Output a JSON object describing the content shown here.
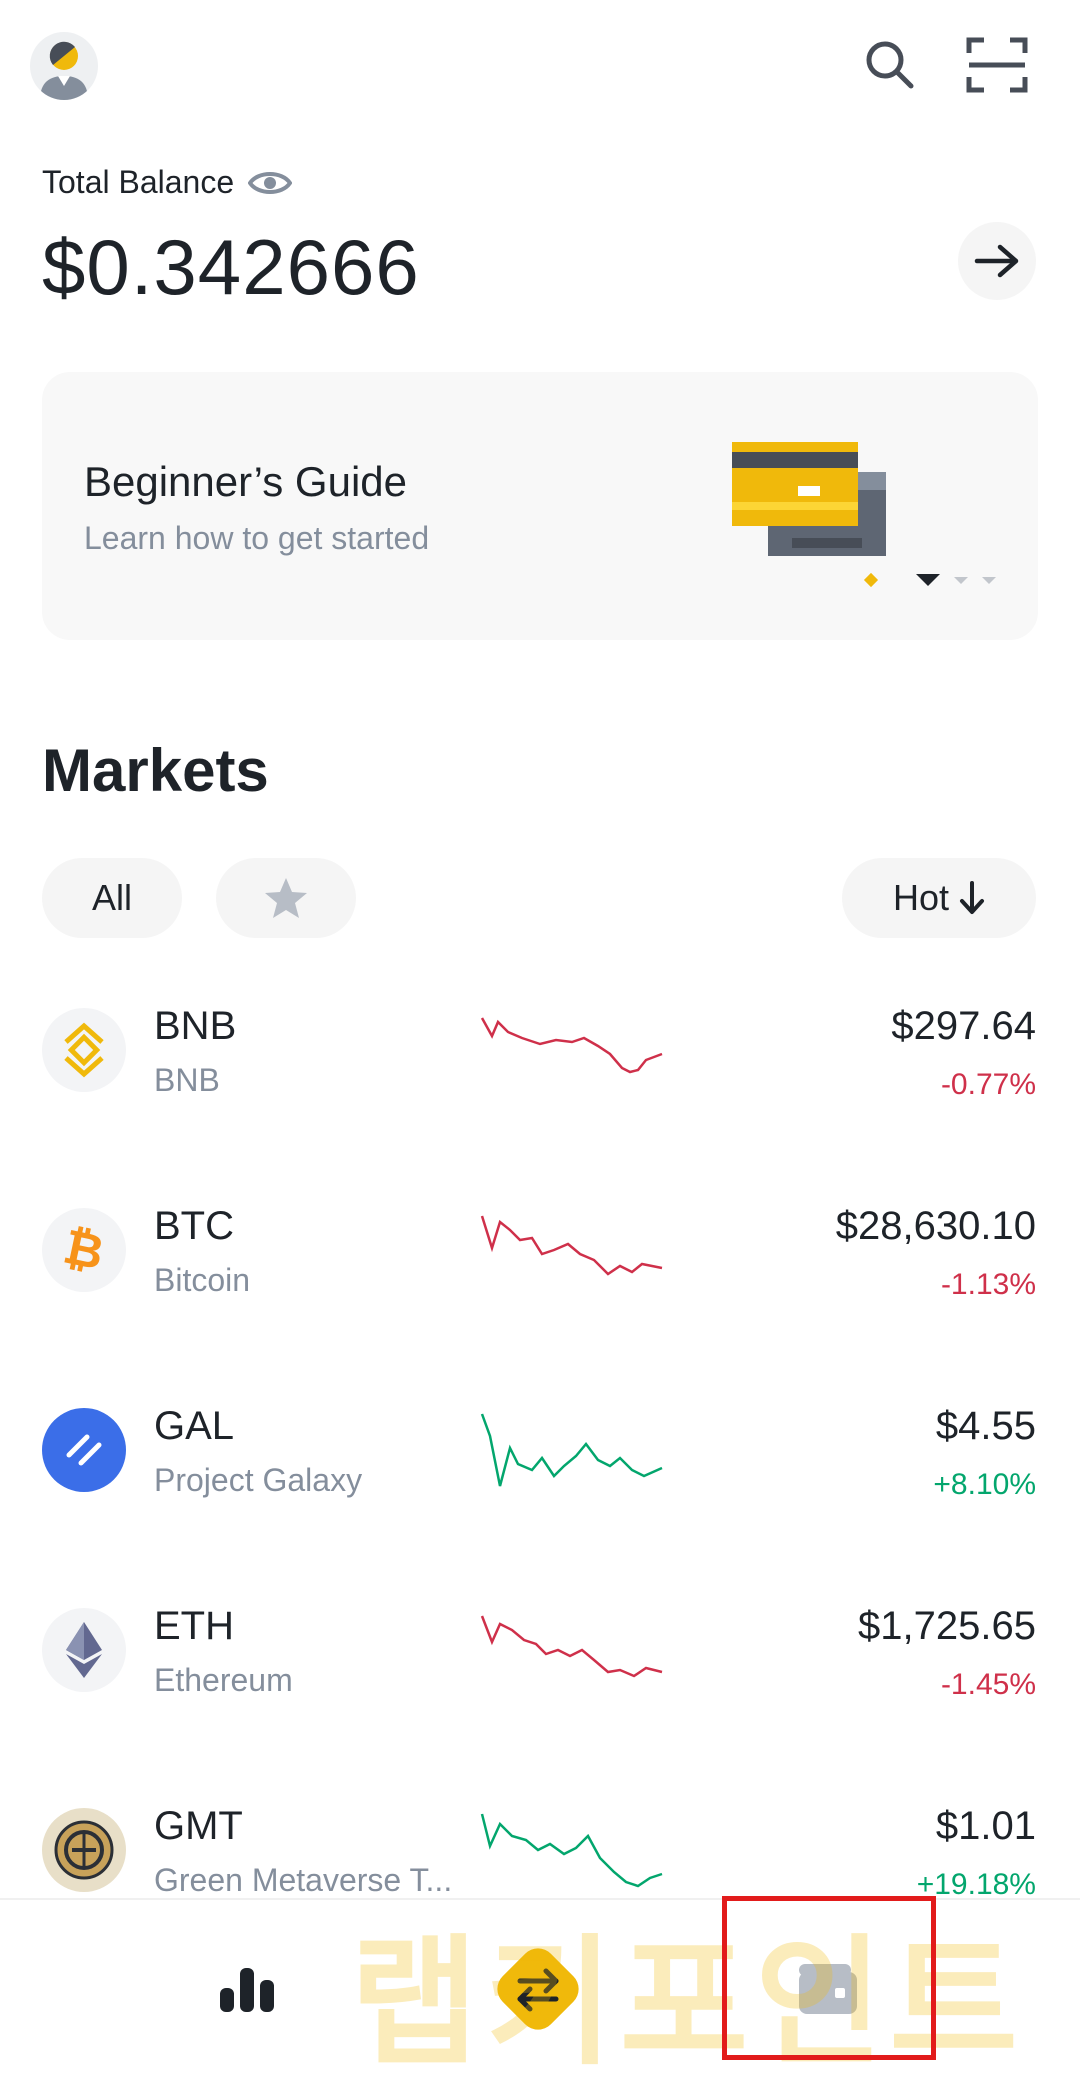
{
  "balance": {
    "label": "Total Balance",
    "value": "$0.342666"
  },
  "banner": {
    "title": "Beginner’s Guide",
    "subtitle": "Learn how to get started"
  },
  "markets": {
    "title": "Markets",
    "tabs": {
      "all": "All",
      "sort": "Hot"
    },
    "rows": [
      {
        "symbol": "BNB",
        "name": "BNB",
        "price": "$297.64",
        "change": "-0.77%",
        "trend": "down"
      },
      {
        "symbol": "BTC",
        "name": "Bitcoin",
        "price": "$28,630.10",
        "change": "-1.13%",
        "trend": "down"
      },
      {
        "symbol": "GAL",
        "name": "Project Galaxy",
        "price": "$4.55",
        "change": "+8.10%",
        "trend": "up"
      },
      {
        "symbol": "ETH",
        "name": "Ethereum",
        "price": "$1,725.65",
        "change": "-1.45%",
        "trend": "down"
      },
      {
        "symbol": "GMT",
        "name": "Green Metaverse T...",
        "price": "$1.01",
        "change": "+19.18%",
        "trend": "up"
      }
    ]
  },
  "colors": {
    "negative": "#cf304a",
    "positive": "#03a66d",
    "brand": "#f0b90b",
    "highlight_box": "#e21b1b"
  },
  "watermark": "랩키포인트",
  "icons": {
    "avatar": "avatar-icon",
    "search": "search-icon",
    "scan": "scan-icon",
    "eye": "eye-icon",
    "arrow": "arrow-right-icon",
    "star": "star-icon",
    "sort": "arrow-down-icon",
    "markets_nav": "bar-chart-icon",
    "trade_nav": "swap-icon",
    "wallet_nav": "wallet-icon"
  }
}
